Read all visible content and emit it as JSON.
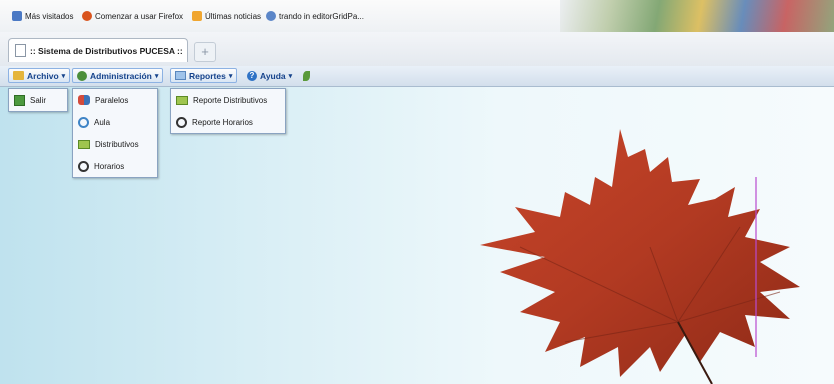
{
  "browser": {
    "bookmarks": [
      {
        "label": "Más visitados",
        "icon": "star-icon"
      },
      {
        "label": "Comenzar a usar Firefox",
        "icon": "firefox-icon"
      },
      {
        "label": "Últimas noticias",
        "icon": "rss-icon"
      },
      {
        "label": "trando in editorGridPa...",
        "icon": "globe-icon"
      }
    ],
    "active_tab": {
      "title": ":: Sistema de Distributivos PUCESA ::"
    },
    "new_tab_label": "+"
  },
  "menubar": {
    "items": [
      {
        "label": "Archivo",
        "icon": "folder-icon"
      },
      {
        "label": "Administración",
        "icon": "gears-icon"
      },
      {
        "label": "Reportes",
        "icon": "report-icon"
      },
      {
        "label": "Ayuda",
        "icon": "help-icon"
      }
    ]
  },
  "menus": {
    "archivo": [
      {
        "label": "Salir",
        "icon": "exit-icon"
      }
    ],
    "administracion": [
      {
        "label": "Paralelos",
        "icon": "people-icon"
      },
      {
        "label": "Aula",
        "icon": "classroom-icon"
      },
      {
        "label": "Distributivos",
        "icon": "distributive-icon"
      },
      {
        "label": "Horarios",
        "icon": "clock-icon"
      }
    ],
    "reportes": [
      {
        "label": "Reporte Distributivos",
        "icon": "distributive-icon"
      },
      {
        "label": "Reporte Horarios",
        "icon": "clock-icon"
      }
    ]
  },
  "colors": {
    "menu_text": "#15428b",
    "leaf": "#b23a22",
    "background": "#d8eef5"
  }
}
